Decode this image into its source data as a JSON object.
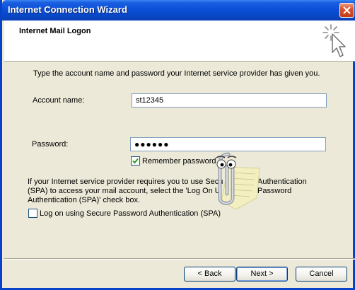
{
  "window": {
    "title": "Internet Connection Wizard"
  },
  "header": {
    "title": "Internet Mail Logon"
  },
  "intro_text": "Type the account name and password your Internet service provider has given you.",
  "account": {
    "label": "Account name:",
    "value": "st12345"
  },
  "password": {
    "label": "Password:",
    "value": "●●●●●●"
  },
  "remember_password": {
    "label": "Remember password",
    "checked": true
  },
  "spa_text": {
    "line1_left": "If your Internet service provider requires you to use Secu",
    "line1_right": "Authentication",
    "line2_left": "(SPA) to access your mail account, select the 'Log On U",
    "line2_right": "Password",
    "line3": "Authentication (SPA)' check box."
  },
  "spa_checkbox": {
    "label": "Log on using Secure Password Authentication (SPA)",
    "checked": false
  },
  "buttons": {
    "back": "< Back",
    "next": "Next >",
    "cancel": "Cancel"
  },
  "icons": {
    "close": "close-icon",
    "wizard": "wizard-cursor-icon",
    "assistant": "clippy-assistant-icon"
  }
}
